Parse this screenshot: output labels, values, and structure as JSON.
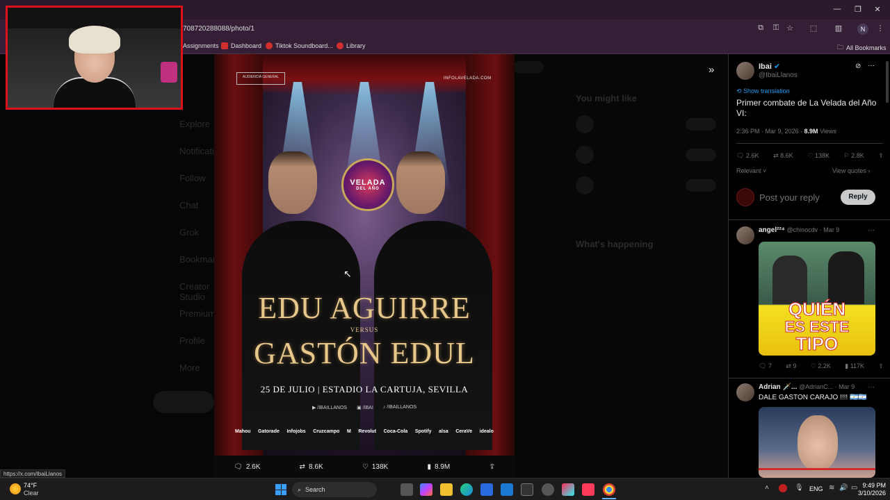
{
  "browser": {
    "url": "708720288088/photo/1",
    "bookmarks": [
      {
        "label": "Assignments",
        "color": ""
      },
      {
        "label": "Dashboard",
        "color": "#d12e2e"
      },
      {
        "label": "Tiktok Soundboard...",
        "color": "#d12e2e"
      },
      {
        "label": "Library",
        "color": "#d12e2e"
      }
    ],
    "all_bookmarks": "All Bookmarks",
    "profile_initial": "N",
    "status_url": "https://x.com/IbaiLlanos"
  },
  "background": {
    "nav": [
      "Explore",
      "Notifications",
      "Follow",
      "Chat",
      "Grok",
      "Bookmarks",
      "Creator Studio",
      "Premium",
      "Profile",
      "More"
    ],
    "right_heads": [
      "You might like",
      "What's happening"
    ]
  },
  "poster": {
    "badge": "AUDIENCIA GENERAL",
    "site": "INFOLAVELADA.COM",
    "logo_top": "VELADA",
    "logo_bottom": "DEL AÑO",
    "name1": "EDU AGUIRRE",
    "versus": "VERSUS",
    "name2": "GASTÓN EDUL",
    "event_date": "25 DE JULIO | ESTADIO LA CARTUJA, SEVILLA",
    "socials": [
      "/IBAILLANOS",
      "/IBAI",
      "/IBAILLANOS"
    ],
    "sponsors": [
      "Mahou",
      "Gatorade",
      "Infojobs",
      "Cruzcampo",
      "M",
      "Revolut",
      "Coca-Cola",
      "Spotify",
      "alsa",
      "CeraVe",
      "idealo"
    ]
  },
  "media_actions": {
    "replies": "2.6K",
    "reposts": "8.6K",
    "likes": "138K",
    "views": "8.9M"
  },
  "tweet": {
    "author": "Ibai",
    "handle": "@IbaiLlanos",
    "show_translation": "Show translation",
    "text": "Primer combate de La Velada del Año VI:",
    "time": "2:36 PM · Mar 9, 2026 · ",
    "views_count": "8.9M",
    "views_label": " Views",
    "replies": "2.6K",
    "reposts": "8.6K",
    "likes": "138K",
    "bookmarks": "2.8K",
    "sort": "Relevant",
    "view_quotes": "View quotes",
    "reply_placeholder": "Post your reply",
    "reply_button": "Reply"
  },
  "replies": [
    {
      "author": "angel²²⁴",
      "handle": "@chinocdv",
      "date": " · Mar 9",
      "meme_line1": "QUIÉN",
      "meme_line2": "ES ESTE",
      "meme_line3": "TIPO",
      "replies": "7",
      "reposts": "9",
      "likes": "2.2K",
      "views": "117K"
    },
    {
      "author": "Adrian 🗡️...",
      "handle": "@AdrianC...",
      "date": " · Mar 9",
      "text": "DALE GASTON CARAJO !!!! 🇦🇷🇦🇷"
    }
  ],
  "taskbar": {
    "weather_temp": "74°F",
    "weather_desc": "Clear",
    "search": "Search",
    "lang": "ENG",
    "time": "9:49 PM",
    "date": "3/10/2026"
  }
}
